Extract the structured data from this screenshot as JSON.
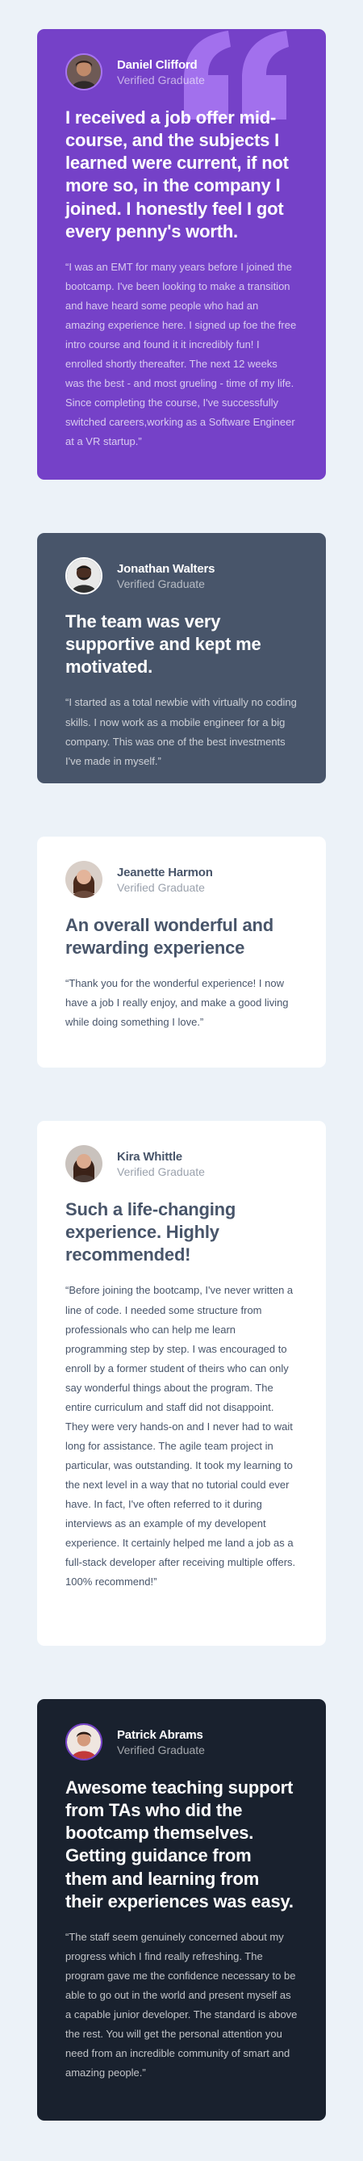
{
  "testimonials": [
    {
      "name": "Daniel Clifford",
      "role": "Verified Graduate",
      "avatar_icon": "avatar-daniel-icon",
      "headline": "I received a job offer mid-course, and the subjects I learned were current, if not more so, in the company I joined. I honestly feel I got every penny's worth.",
      "body": "“I was an EMT for many years before I joined the bootcamp. I've been looking to make a transition and have heard some people who had an amazing experience here. I signed up foe the free intro course and found it it incredibly fun! I enrolled shortly thereafter. The next 12 weeks was the best - and most grueling - time of my life. Since completing the course, I've successfully switched careers,working as a Software Engineer at a VR startup.”",
      "theme_color": "#7541c8"
    },
    {
      "name": "Jonathan Walters",
      "role": "Verified Graduate",
      "avatar_icon": "avatar-jonathan-icon",
      "headline": "The team was very supportive and kept me motivated.",
      "body": "“I started as a total newbie with virtually no coding skills. I now work as a mobile engineer for a big company. This was one of the best investments I've made in myself.”",
      "theme_color": "#48556a"
    },
    {
      "name": "Jeanette Harmon",
      "role": "Verified Graduate",
      "avatar_icon": "avatar-jeanette-icon",
      "headline": "An overall wonderful and rewarding experience",
      "body": "“Thank you for the wonderful experience! I now have a job I really enjoy, and make a good living while doing something I love.”",
      "theme_color": "#ffffff"
    },
    {
      "name": "Kira Whittle",
      "role": "Verified Graduate",
      "avatar_icon": "avatar-kira-icon",
      "headline": "Such a life-changing experience. Highly recommended!",
      "body": "“Before joining the bootcamp, I've never written a line of code. I needed some structure from professionals who can help me learn programming step by step. I was encouraged to enroll by a former student of theirs who can only say wonderful things about the program. The entire curriculum and staff did not disappoint. They were very hands-on and I never had to wait long for assistance. The agile team project in particular, was outstanding. It took my learning to the next level in a way that no tutorial could ever have. In fact, I've often referred to it during interviews as an example of my developent experience. It certainly helped me land a job as a full-stack developer after receiving multiple offers. 100% recommend!”",
      "theme_color": "#ffffff"
    },
    {
      "name": "Patrick Abrams",
      "role": "Verified Graduate",
      "avatar_icon": "avatar-patrick-icon",
      "headline": "Awesome teaching support from TAs who did the bootcamp themselves. Getting guidance from them and learning from their experiences was easy.",
      "body": "“The staff seem genuinely concerned about my progress which I find really refreshing. The program gave me the confidence necessary to be able to go out in the world and present myself as a capable junior developer. The standard is above the rest. You will get the personal attention you need from an incredible community of smart and amazing people.”",
      "theme_color": "#19212e"
    }
  ],
  "decor": {
    "quote_icon": "quote-mark-icon",
    "quote_color": "#a775f1",
    "page_bg": "#ecf2f8"
  }
}
